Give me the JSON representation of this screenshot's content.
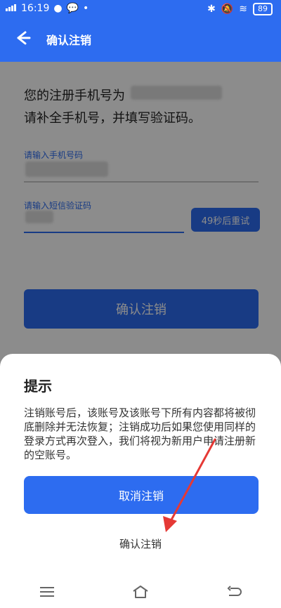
{
  "status_bar": {
    "time": "16:19",
    "battery": "89"
  },
  "app_bar": {
    "title": "确认注销"
  },
  "page": {
    "intro_line1": "您的注册手机号为",
    "intro_line2": "请补全手机号，并填写验证码。",
    "phone_label": "请输入手机号码",
    "code_label": "请输入短信验证码",
    "resend_label": "49秒后重试",
    "confirm_button_label": "确认注销"
  },
  "dialog": {
    "title": "提示",
    "body": "注销账号后，该账号及该账号下所有内容都将被彻底删除并无法恢复；注销成功后如果您使用同样的登录方式再次登入，我们将视为新用户申请注册新的空账号。",
    "cancel_label": "取消注销",
    "confirm_label": "确认注销"
  },
  "colors": {
    "primary": "#2d6cf0",
    "annotation_arrow": "#e53935"
  },
  "icons": {
    "back": "back-arrow-icon",
    "menu": "menu-icon",
    "home": "home-icon",
    "back_nav": "back-nav-icon"
  }
}
